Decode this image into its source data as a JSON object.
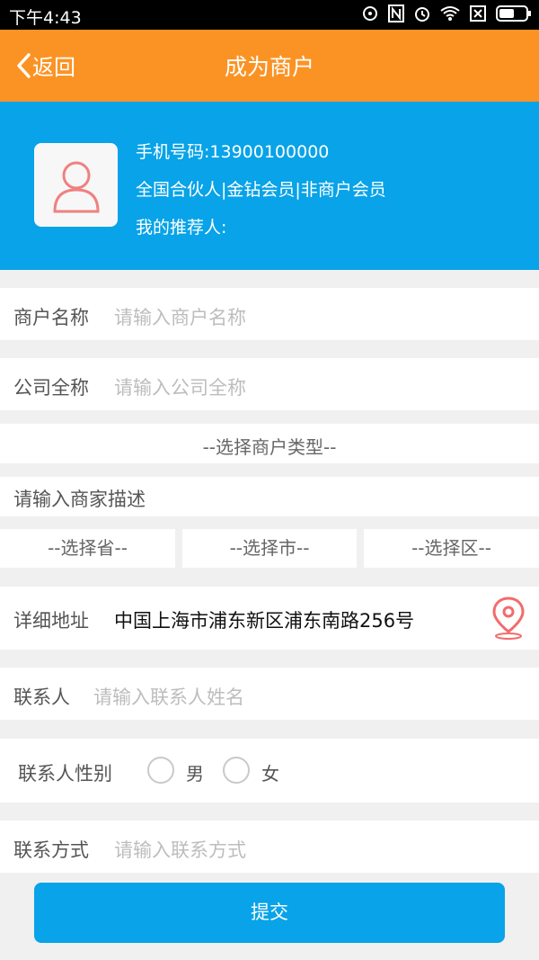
{
  "status_bar": {
    "time": "下午4:43",
    "icons": [
      "alarm-icon",
      "nfc-icon",
      "clock-icon",
      "wifi-icon",
      "sim-icon",
      "battery-icon"
    ]
  },
  "header": {
    "back_label": "返回",
    "title": "成为商户"
  },
  "profile": {
    "phone": "手机号码:13900100000",
    "membership": "全国合伙人|金钻会员|非商户会员",
    "referrer": "我的推荐人:"
  },
  "form": {
    "merchant_name": {
      "label": "商户名称",
      "placeholder": "请输入商户名称"
    },
    "company_name": {
      "label": "公司全称",
      "placeholder": "请输入公司全称"
    },
    "merchant_type": "--选择商户类型--",
    "description_placeholder": "请输入商家描述",
    "region": {
      "province": "--选择省--",
      "city": "--选择市--",
      "district": "--选择区--"
    },
    "address": {
      "label": "详细地址",
      "value": "中国上海市浦东新区浦东南路256号"
    },
    "contact": {
      "label": "联系人",
      "placeholder": "请输入联系人姓名"
    },
    "gender": {
      "label": "联系人性别",
      "options": [
        "男",
        "女"
      ]
    },
    "phone": {
      "label": "联系方式",
      "placeholder": "请输入联系方式"
    }
  },
  "submit_label": "提交",
  "colors": {
    "orange": "#fb9324",
    "blue": "#08a3e8",
    "pin": "#f36b6b"
  }
}
